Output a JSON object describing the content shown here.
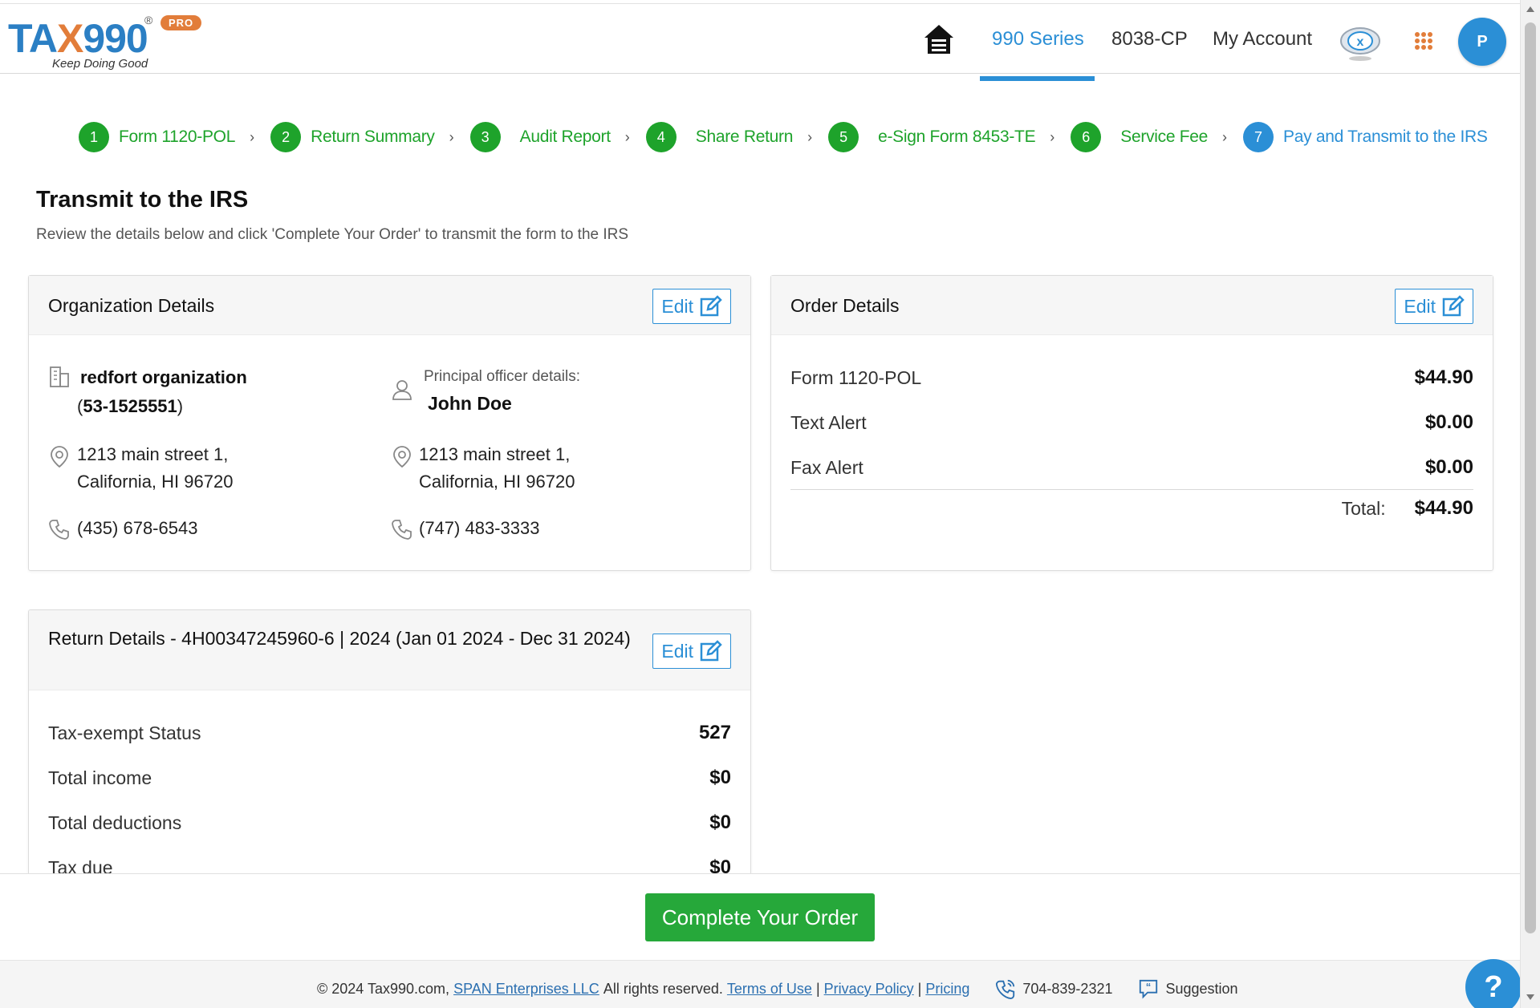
{
  "logo": {
    "brand_a": "TA",
    "brand_x": "X",
    "brand_b": "990",
    "reg": "®",
    "badge": "PRO",
    "tagline": "Keep Doing Good"
  },
  "nav": {
    "links": [
      {
        "label": "990 Series",
        "active": true
      },
      {
        "label": "8038-CP",
        "active": false
      },
      {
        "label": "My Account",
        "active": false
      }
    ],
    "avatar_initial": "P",
    "icons": [
      "home-icon",
      "tax-robot-icon",
      "apps-grid-icon"
    ]
  },
  "steps": [
    {
      "num": "1",
      "label": "Form 1120-POL",
      "active": false
    },
    {
      "num": "2",
      "label": "Return Summary",
      "active": false
    },
    {
      "num": "3",
      "label": "Audit Report",
      "active": false
    },
    {
      "num": "4",
      "label": "Share Return",
      "active": false
    },
    {
      "num": "5",
      "label": "e-Sign Form 8453-TE",
      "active": false
    },
    {
      "num": "6",
      "label": "Service Fee",
      "active": false
    },
    {
      "num": "7",
      "label": "Pay and Transmit to the IRS",
      "active": true
    }
  ],
  "page": {
    "title": "Transmit to the IRS",
    "subtitle": "Review the details below and click 'Complete Your Order' to transmit the form to the IRS"
  },
  "org": {
    "title": "Organization Details",
    "edit_label": "Edit",
    "name": "redfort organization",
    "ein_open": "(",
    "ein": "53-1525551",
    "ein_close": ")",
    "address_line1": "1213 main street 1,",
    "address_line2": "California, HI 96720",
    "phone": "(435) 678-6543",
    "officer_label": "Principal officer details:",
    "officer_name": "John Doe",
    "officer_address_line1": "1213 main street 1,",
    "officer_address_line2": "California, HI 96720",
    "officer_phone": "(747) 483-3333"
  },
  "order": {
    "title": "Order Details",
    "edit_label": "Edit",
    "items": [
      {
        "label": "Form 1120-POL",
        "amount": "$44.90"
      },
      {
        "label": "Text Alert",
        "amount": "$0.00"
      },
      {
        "label": "Fax Alert",
        "amount": "$0.00"
      }
    ],
    "total_label": "Total:",
    "total_amount": "$44.90"
  },
  "return": {
    "title": "Return Details - 4H00347245960-6 | 2024 (Jan 01 2024 - Dec 31 2024)",
    "edit_label": "Edit",
    "rows": [
      {
        "label": "Tax-exempt Status",
        "value": "527"
      },
      {
        "label": "Total income",
        "value": "$0"
      },
      {
        "label": "Total deductions",
        "value": "$0"
      },
      {
        "label": "Tax due",
        "value": "$0"
      }
    ]
  },
  "action": {
    "complete_label": "Complete Your Order"
  },
  "footer": {
    "copyright": "© 2024 Tax990.com,",
    "company": "SPAN Enterprises LLC",
    "rights": "All rights reserved.",
    "terms": "Terms of Use",
    "privacy": "Privacy Policy",
    "pricing": "Pricing",
    "separator": "|",
    "phone": "704-839-2321",
    "suggestion": "Suggestion"
  },
  "help": {
    "label": "?"
  },
  "colors": {
    "primary": "#2b8fd6",
    "success": "#1ea32b",
    "accent": "#e27d3a"
  }
}
